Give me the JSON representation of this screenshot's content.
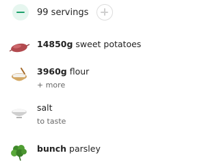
{
  "servings": {
    "label": "99 servings"
  },
  "ingredients": [
    {
      "quantity": "14850g",
      "name": "sweet potatoes",
      "sub": "",
      "icon": "sweet-potato-icon"
    },
    {
      "quantity": "3960g",
      "name": "flour",
      "sub": "+ more",
      "icon": "flour-bowl-icon"
    },
    {
      "quantity": "",
      "name": "salt",
      "sub": "to taste",
      "icon": "salt-bowl-icon"
    },
    {
      "quantity": "bunch",
      "name": "parsley",
      "sub": "",
      "icon": "parsley-icon"
    }
  ],
  "colors": {
    "accent": "#1aa06a",
    "accent_bg": "#e6f6ef",
    "text": "#222222",
    "muted": "#666666"
  }
}
